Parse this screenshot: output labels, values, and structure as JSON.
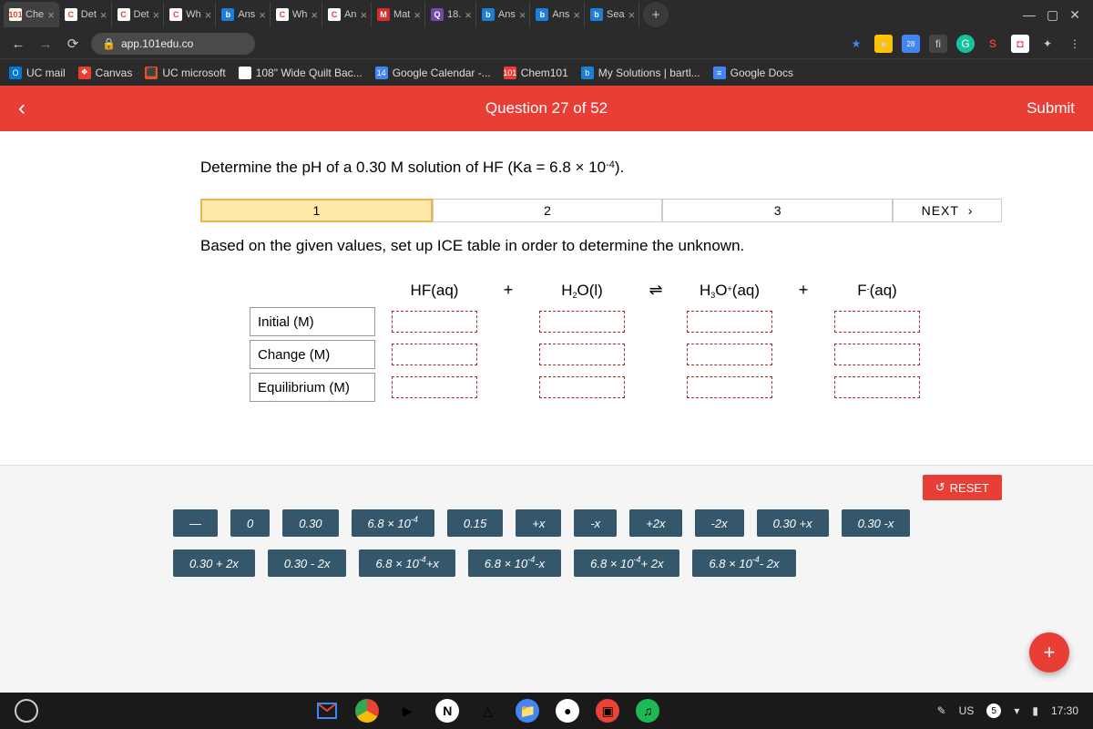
{
  "browser": {
    "tabs": [
      {
        "title": "Che",
        "icon": "101",
        "bg": "#fff",
        "fg": "#e83e35",
        "active": true
      },
      {
        "title": "Det",
        "icon": "C",
        "bg": "#fff",
        "fg": "#e83e35"
      },
      {
        "title": "Det",
        "icon": "C",
        "bg": "#fff",
        "fg": "#e83e35"
      },
      {
        "title": "Wh",
        "icon": "C",
        "bg": "#fff",
        "fg": "#e83e35"
      },
      {
        "title": "Ans",
        "icon": "b",
        "bg": "#1c7ed6",
        "fg": "#fff"
      },
      {
        "title": "Wh",
        "icon": "C",
        "bg": "#fff",
        "fg": "#e83e35"
      },
      {
        "title": "An",
        "icon": "C",
        "bg": "#fff",
        "fg": "#e83e35"
      },
      {
        "title": "Mat",
        "icon": "M",
        "bg": "#d32f2f",
        "fg": "#fff"
      },
      {
        "title": "18.",
        "icon": "Q",
        "bg": "#6b4ba3",
        "fg": "#fff"
      },
      {
        "title": "Ans",
        "icon": "b",
        "bg": "#1c7ed6",
        "fg": "#fff"
      },
      {
        "title": "Ans",
        "icon": "b",
        "bg": "#1c7ed6",
        "fg": "#fff"
      },
      {
        "title": "Sea",
        "icon": "b",
        "bg": "#1c7ed6",
        "fg": "#fff"
      }
    ],
    "url": "app.101edu.co",
    "bookmarks": [
      {
        "label": "UC mail",
        "icon": "O",
        "bg": "#0078d4"
      },
      {
        "label": "Canvas",
        "icon": "❖",
        "bg": "#e83e35"
      },
      {
        "label": "UC microsoft",
        "icon": "⬛",
        "bg": "#f25022"
      },
      {
        "label": "108\" Wide Quilt Bac...",
        "icon": "G",
        "bg": "#fff"
      },
      {
        "label": "Google Calendar -...",
        "icon": "14",
        "bg": "#4285f4"
      },
      {
        "label": "Chem101",
        "icon": "101",
        "bg": "#e83e35"
      },
      {
        "label": "My Solutions | bartl...",
        "icon": "b",
        "bg": "#1c7ed6"
      },
      {
        "label": "Google Docs",
        "icon": "≡",
        "bg": "#4285f4"
      }
    ]
  },
  "app": {
    "question_label": "Question 27 of 52",
    "submit": "Submit",
    "prompt_pre": "Determine the pH of a 0.30 M solution of HF (Ka = 6.8 × 10",
    "prompt_sup": "-4",
    "prompt_post": ").",
    "steps": [
      "1",
      "2",
      "3"
    ],
    "next": "NEXT",
    "instruction": "Based on the given values, set up ICE table in order to determine the unknown.",
    "ice": {
      "cols": [
        "HF(aq)",
        "H₂O(l)",
        "H₃O⁺(aq)",
        "F⁻(aq)"
      ],
      "seps": [
        "+",
        "⇌",
        "+"
      ],
      "rows": [
        "Initial (M)",
        "Change (M)",
        "Equilibrium (M)"
      ]
    },
    "reset": "RESET",
    "chips": [
      "—",
      "0",
      "0.30",
      "6.8 × 10⁻⁴",
      "0.15",
      "+x",
      "-x",
      "+2x",
      "-2x",
      "0.30 + x",
      "0.30 - x",
      "0.30 + 2x",
      "0.30 - 2x",
      "6.8 × 10⁻⁴ + x",
      "6.8 × 10⁻⁴ - x",
      "6.8 × 10⁻⁴ + 2x",
      "6.8 × 10⁻⁴ - 2x"
    ]
  },
  "shelf": {
    "keyboard": "US",
    "notif": "5",
    "time": "17:30"
  }
}
